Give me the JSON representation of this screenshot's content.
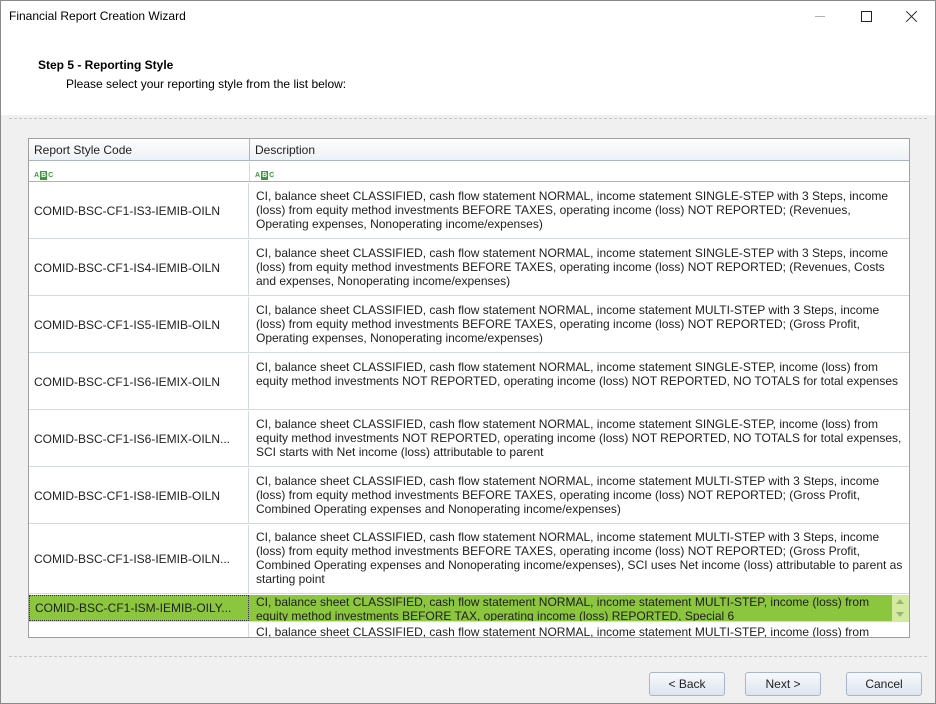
{
  "window": {
    "title": "Financial Report Creation Wizard"
  },
  "header": {
    "step_title": "Step 5 - Reporting Style",
    "step_subtitle": "Please select your reporting style from the list below:"
  },
  "grid": {
    "columns": [
      "Report Style Code",
      "Description"
    ],
    "filter_icon": "abc-filter-icon",
    "rows": [
      {
        "code": "COMID-BSC-CF1-IS3-IEMIB-OILN",
        "description": "CI, balance sheet CLASSIFIED, cash flow statement NORMAL, income statement SINGLE-STEP with 3 Steps, income (loss) from equity method investments BEFORE TAXES, operating income (loss) NOT REPORTED; (Revenues, Operating expenses, Nonoperating income/expenses)"
      },
      {
        "code": "COMID-BSC-CF1-IS4-IEMIB-OILN",
        "description": "CI, balance sheet CLASSIFIED, cash flow statement NORMAL, income statement SINGLE-STEP with 3 Steps, income (loss) from equity method investments BEFORE TAXES, operating income (loss) NOT REPORTED; (Revenues, Costs and expenses, Nonoperating income/expenses)"
      },
      {
        "code": "COMID-BSC-CF1-IS5-IEMIB-OILN",
        "description": "CI, balance sheet CLASSIFIED, cash flow statement NORMAL, income statement MULTI-STEP with 3 Steps, income (loss) from equity method investments BEFORE TAXES, operating income (loss) NOT REPORTED; (Gross Profit, Operating expenses, Nonoperating income/expenses)"
      },
      {
        "code": "COMID-BSC-CF1-IS6-IEMIX-OILN",
        "description": "CI, balance sheet CLASSIFIED, cash flow statement NORMAL, income statement SINGLE-STEP, income (loss) from equity method investments NOT REPORTED, operating income (loss) NOT REPORTED, NO TOTALS for total expenses"
      },
      {
        "code": "COMID-BSC-CF1-IS6-IEMIX-OILN...",
        "description": "CI, balance sheet CLASSIFIED, cash flow statement NORMAL, income statement SINGLE-STEP, income (loss) from equity method investments NOT REPORTED, operating income (loss) NOT REPORTED, NO TOTALS for total expenses, SCI starts with Net income (loss) attributable to parent"
      },
      {
        "code": "COMID-BSC-CF1-IS8-IEMIB-OILN",
        "description": "CI, balance sheet CLASSIFIED, cash flow statement NORMAL, income statement MULTI-STEP with 3 Steps, income (loss) from equity method investments BEFORE TAXES, operating income (loss) NOT REPORTED; (Gross Profit, Combined Operating expenses and Nonoperating income/expenses)"
      },
      {
        "code": "COMID-BSC-CF1-IS8-IEMIB-OILN...",
        "description": "CI, balance sheet CLASSIFIED, cash flow statement NORMAL, income statement MULTI-STEP with 3 Steps, income (loss) from equity method investments BEFORE TAXES, operating income (loss) NOT REPORTED; (Gross Profit, Combined Operating expenses and Nonoperating income/expenses), SCI uses Net income (loss) attributable to parent as starting point"
      },
      {
        "code": "COMID-BSC-CF1-ISM-IEMIB-OILY...",
        "description": "CI, balance sheet CLASSIFIED, cash flow statement NORMAL, income statement MULTI-STEP, income (loss) from equity method investments BEFORE TAX, operating income (loss) REPORTED, Special 6",
        "selected": true
      },
      {
        "code": "",
        "description": "CI, balance sheet CLASSIFIED, cash flow statement NORMAL, income statement MULTI-STEP, income (loss) from"
      }
    ]
  },
  "buttons": {
    "back": "< Back",
    "next": "Next >",
    "cancel": "Cancel"
  },
  "colors": {
    "selected_row": "#8cc63f",
    "filter_icon": "#3a9a3a"
  }
}
